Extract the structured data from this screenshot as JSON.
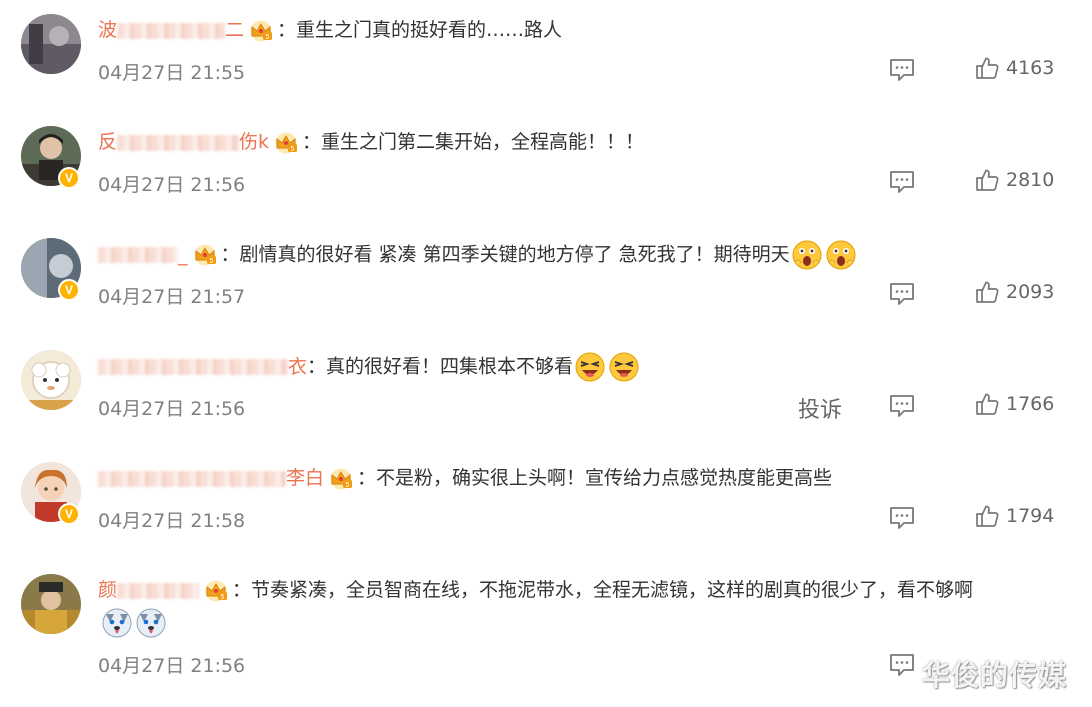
{
  "comments": [
    {
      "username_visible_start": "波",
      "username_visible_end": "二",
      "text": "：重生之门真的挺好看的……路人",
      "time": "04月27日 21:55",
      "likes": "4163",
      "verified": false,
      "emojis": []
    },
    {
      "username_visible_start": "反",
      "username_visible_end": "伤k",
      "text": "：重生之门第二集开始，全程高能！！！",
      "time": "04月27日 21:56",
      "likes": "2810",
      "verified": true,
      "emojis": []
    },
    {
      "username_visible_start": "",
      "username_visible_end": "_",
      "text": "：剧情真的很好看 紧凑 第四季关键的地方停了 急死我了！期待明天",
      "time": "04月27日 21:57",
      "likes": "2093",
      "verified": true,
      "emojis": [
        "scared-face",
        "scared-face"
      ]
    },
    {
      "username_visible_start": "",
      "username_visible_end": "衣",
      "text": "：真的很好看！四集根本不够看",
      "time": "04月27日 21:56",
      "likes": "1766",
      "verified": false,
      "emojis": [
        "crying-face",
        "crying-face"
      ]
    },
    {
      "username_visible_start": "",
      "username_visible_end": "李白",
      "text": "：不是粉，确实很上头啊！宣传给力点感觉热度能更高些",
      "time": "04月27日 21:58",
      "likes": "1794",
      "verified": true,
      "emojis": []
    },
    {
      "username_visible_start": "颜",
      "username_visible_end": "",
      "text": "：节奏紧凑，全员智商在线，不拖泥带水，全程无滤镜，这样的剧真的很少了，看不够啊",
      "time": "04月27日 21:56",
      "likes": "",
      "verified": false,
      "emojis": [
        "husky-face",
        "husky-face"
      ]
    }
  ],
  "report_label": "投诉",
  "watermark": "华俊的传媒",
  "colors": {
    "username": "#eb7350",
    "time": "#808080",
    "verified_badge": "#ffb300"
  }
}
